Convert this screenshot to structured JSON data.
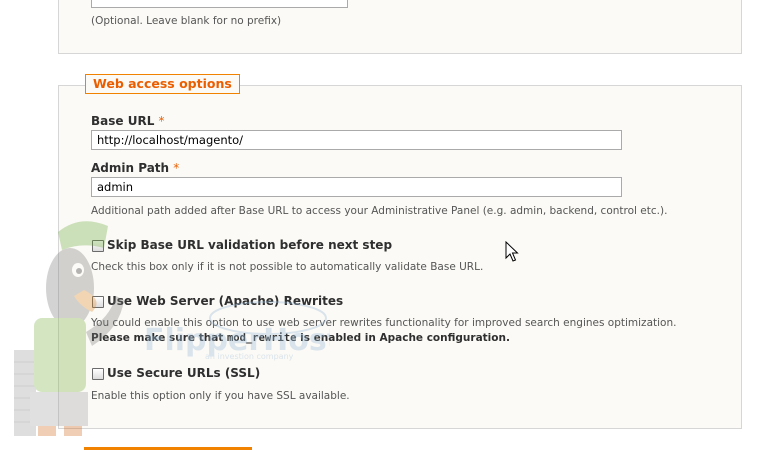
{
  "top_section": {
    "prefix_note": "(Optional. Leave blank for no prefix)"
  },
  "web_access": {
    "legend": "Web access options",
    "required_mark": "*",
    "base_url": {
      "label": "Base URL",
      "value": "http://localhost/magento/"
    },
    "admin_path": {
      "label": "Admin Path",
      "value": "admin",
      "note": "Additional path added after Base URL to access your Administrative Panel (e.g. admin, backend, control etc.)."
    },
    "skip_validation": {
      "label": "Skip Base URL validation before next step",
      "checked": false,
      "note": "Check this box only if it is not possible to automatically validate Base URL."
    },
    "rewrites": {
      "label": "Use Web Server (Apache) Rewrites",
      "checked": false,
      "note": "You could enable this option to use web server rewrites functionality for improved search engines optimization.",
      "warning_before": "Please make sure that ",
      "warning_code": "mod_rewrite",
      "warning_after": " is enabled in Apache configuration."
    },
    "secure_urls": {
      "label": "Use Secure URLs (SSL)",
      "checked": false,
      "note": "Enable this option only if you have SSL available."
    }
  },
  "watermark": {
    "brand": "FlipperHost",
    "tagline": "an investion company"
  },
  "colors": {
    "accent": "#f18200",
    "legend_text": "#eb5e00",
    "panel_bg": "#fbfaf6"
  }
}
